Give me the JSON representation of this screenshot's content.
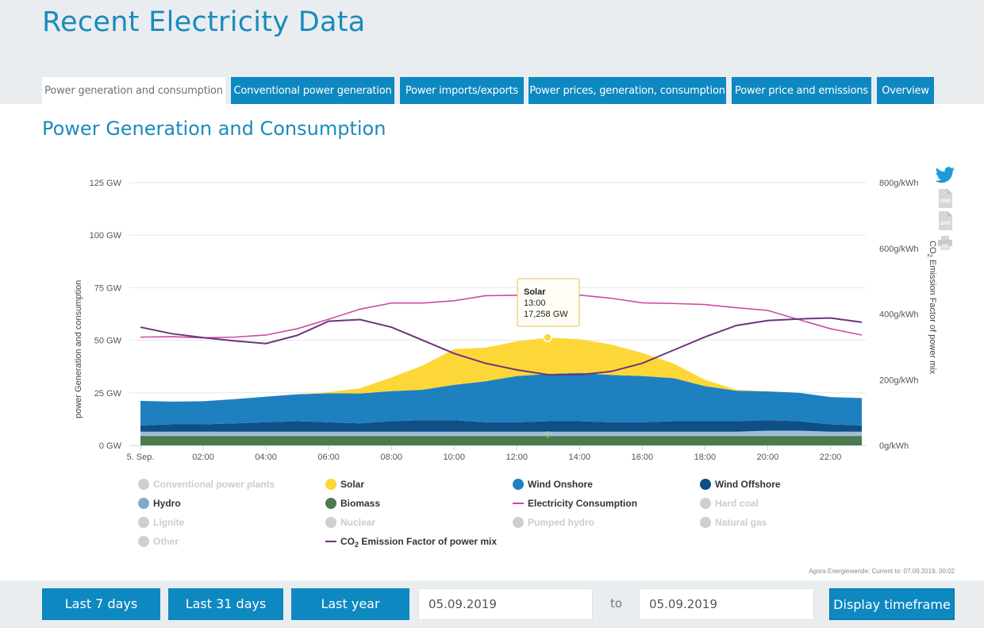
{
  "page_title": "Recent Electricity Data",
  "tabs": [
    {
      "label": "Power generation and consumption",
      "active": true
    },
    {
      "label": "Conventional power generation",
      "active": false
    },
    {
      "label": "Power imports/exports",
      "active": false
    },
    {
      "label": "Power prices, generation, consumption",
      "active": false
    },
    {
      "label": "Power price and emissions",
      "active": false
    },
    {
      "label": "Overview",
      "active": false
    }
  ],
  "section_title": "Power Generation and Consumption",
  "source_note": "Agora Energiewende; Current to: 07.09.2019, 00:02",
  "share_icons": [
    "twitter-icon",
    "png-download-icon",
    "svg-download-icon",
    "print-icon"
  ],
  "share_icon_labels": {
    "png": "PNG",
    "svg": "SVG"
  },
  "tooltip": {
    "series": "Solar",
    "time": "13:00",
    "value": "17,258 GW"
  },
  "chart_data": {
    "type": "area",
    "y_left_label": "power Generation and consumption",
    "y_right_label_prefix": "CO",
    "y_right_label_sub": "2",
    "y_right_label_suffix": " Emission Factor of power mix",
    "y_left_ticks": [
      "0 GW",
      "25 GW",
      "50 GW",
      "75 GW",
      "100 GW",
      "125 GW"
    ],
    "y_left_range": [
      0,
      125
    ],
    "y_right_ticks": [
      "0g/kWh",
      "200g/kWh",
      "400g/kWh",
      "600g/kWh",
      "800g/kWh"
    ],
    "y_right_range": [
      0,
      800
    ],
    "x_ticks": [
      "5. Sep.",
      "02:00",
      "04:00",
      "06:00",
      "08:00",
      "10:00",
      "12:00",
      "14:00",
      "16:00",
      "18:00",
      "20:00",
      "22:00"
    ],
    "x_tick_hours": [
      0,
      2,
      4,
      6,
      8,
      10,
      12,
      14,
      16,
      18,
      20,
      22
    ],
    "x_range_hours": [
      0,
      23
    ],
    "hours": [
      0,
      1,
      2,
      3,
      4,
      5,
      6,
      7,
      8,
      9,
      10,
      11,
      12,
      13,
      14,
      15,
      16,
      17,
      18,
      19,
      20,
      21,
      22,
      23
    ],
    "stack": [
      {
        "name": "Biomass",
        "color": "#4a7a4e",
        "values": [
          4.5,
          4.5,
          4.5,
          4.5,
          4.5,
          4.5,
          4.5,
          4.5,
          4.5,
          4.5,
          4.5,
          4.5,
          4.5,
          4.5,
          4.5,
          4.5,
          4.5,
          4.5,
          4.5,
          4.5,
          4.5,
          4.5,
          4.5,
          4.5
        ]
      },
      {
        "name": "Hydro",
        "color": "#9fbfd6",
        "values": [
          2.0,
          2.0,
          2.0,
          2.0,
          2.0,
          2.0,
          2.0,
          2.0,
          2.0,
          2.0,
          2.0,
          2.0,
          2.0,
          2.0,
          2.0,
          2.0,
          2.0,
          2.0,
          2.0,
          2.0,
          2.5,
          2.5,
          2.0,
          2.0
        ]
      },
      {
        "name": "Wind Offshore",
        "color": "#0e4f86",
        "values": [
          3.0,
          3.5,
          3.5,
          4.0,
          4.5,
          5.0,
          4.5,
          4.0,
          5.0,
          5.5,
          5.5,
          4.5,
          4.5,
          5.0,
          5.0,
          4.5,
          4.5,
          5.0,
          5.0,
          5.0,
          5.0,
          4.5,
          3.5,
          3.0
        ]
      },
      {
        "name": "Wind Onshore",
        "color": "#1f80c0",
        "values": [
          11.7,
          10.8,
          11.0,
          11.5,
          12.2,
          12.8,
          13.8,
          14.2,
          14.3,
          14.5,
          16.8,
          19.5,
          22.0,
          22.5,
          23.0,
          22.5,
          22.0,
          20.5,
          16.7,
          14.5,
          13.7,
          13.5,
          13.0,
          13.0
        ]
      },
      {
        "name": "Solar",
        "color": "#fdd737",
        "values": [
          0,
          0,
          0,
          0,
          0,
          0,
          0.5,
          2.5,
          6.5,
          11.5,
          17.0,
          16.0,
          16.5,
          17.258,
          16.0,
          14.5,
          11.0,
          7.0,
          3.0,
          0.5,
          0,
          0,
          0,
          0
        ]
      }
    ],
    "lines": [
      {
        "name": "Electricity Consumption",
        "axis": "left",
        "color": "#cc4c9e",
        "values": [
          51.5,
          51.7,
          51.2,
          51.5,
          52.5,
          55.5,
          60.0,
          64.8,
          67.7,
          67.7,
          68.8,
          71.2,
          71.4,
          71.3,
          71.5,
          70.0,
          67.8,
          67.5,
          67.0,
          65.5,
          64.2,
          59.8,
          55.5,
          52.5
        ]
      },
      {
        "name": "CO2 Emission Factor of power mix",
        "axis": "right",
        "color": "#6b3580",
        "values": [
          360,
          340,
          328,
          318,
          310,
          335,
          378,
          383,
          360,
          320,
          280,
          250,
          230,
          215,
          215,
          225,
          250,
          290,
          330,
          365,
          380,
          385,
          388,
          375
        ]
      }
    ],
    "legend": [
      {
        "label": "Conventional power plants",
        "marker": "dot",
        "color": "#cfcfcf",
        "enabled": false
      },
      {
        "label": "Solar",
        "marker": "dot",
        "color": "#fdd737",
        "enabled": true
      },
      {
        "label": "Wind Onshore",
        "marker": "dot",
        "color": "#1f80c0",
        "enabled": true
      },
      {
        "label": "Wind Offshore",
        "marker": "dot",
        "color": "#0e4f86",
        "enabled": true
      },
      {
        "label": "Hydro",
        "marker": "dot",
        "color": "#7fa9cc",
        "enabled": true
      },
      {
        "label": "Biomass",
        "marker": "dot",
        "color": "#4a7a4e",
        "enabled": true
      },
      {
        "label": "Electricity Consumption",
        "marker": "line",
        "color": "#cc4c9e",
        "enabled": true
      },
      {
        "label": "Hard coal",
        "marker": "dot",
        "color": "#cfcfcf",
        "enabled": false
      },
      {
        "label": "Lignite",
        "marker": "dot",
        "color": "#cfcfcf",
        "enabled": false
      },
      {
        "label": "Nuclear",
        "marker": "dot",
        "color": "#cfcfcf",
        "enabled": false
      },
      {
        "label": "Pumped hydro",
        "marker": "dot",
        "color": "#cfcfcf",
        "enabled": false
      },
      {
        "label": "Natural gas",
        "marker": "dot",
        "color": "#cfcfcf",
        "enabled": false
      },
      {
        "label": "Other",
        "marker": "dot",
        "color": "#cfcfcf",
        "enabled": false
      },
      {
        "label": "CO",
        "label_sub": "2",
        "label_suffix": " Emission Factor of power mix",
        "marker": "line",
        "color": "#6b3580",
        "enabled": true
      }
    ],
    "grid": true,
    "legend_position": "bottom"
  },
  "controls": {
    "last7": "Last 7 days",
    "last31": "Last 31 days",
    "lastyear": "Last year",
    "from_date": "05.09.2019",
    "to_label": "to",
    "to_date": "05.09.2019",
    "display": "Display timeframe"
  }
}
